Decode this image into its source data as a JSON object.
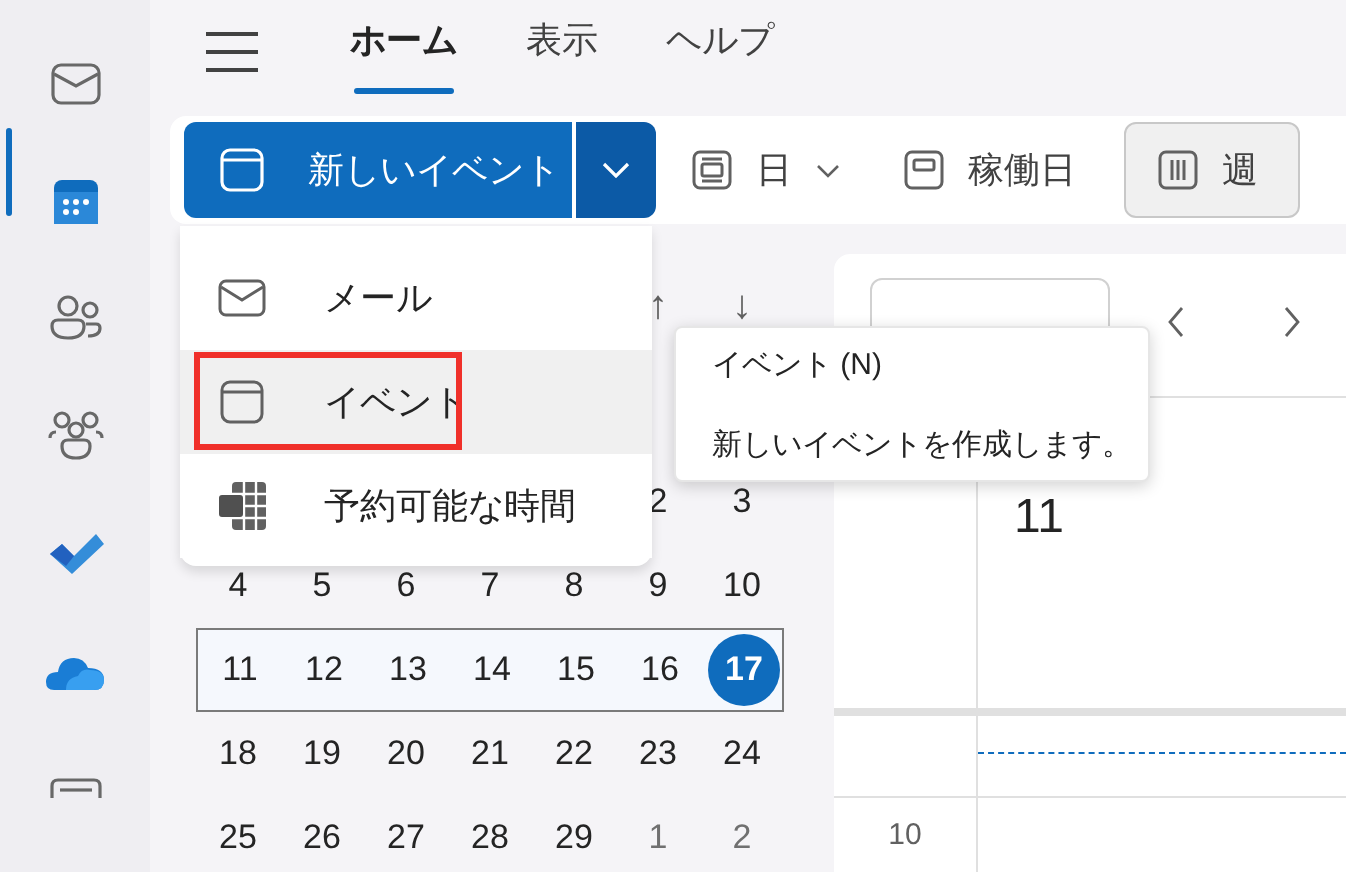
{
  "rail": {
    "items": [
      {
        "kind": "mail",
        "selected": false
      },
      {
        "kind": "calendar",
        "selected": true
      },
      {
        "kind": "people",
        "selected": false
      },
      {
        "kind": "groups",
        "selected": false
      },
      {
        "kind": "todo",
        "selected": false
      },
      {
        "kind": "cloud",
        "selected": false
      },
      {
        "kind": "apps",
        "selected": false
      }
    ]
  },
  "tabs": [
    {
      "label": "ホーム",
      "selected": true
    },
    {
      "label": "表示",
      "selected": false
    },
    {
      "label": "ヘルプ",
      "selected": false
    }
  ],
  "toolbar": {
    "new_event": {
      "label": "新しいイベント"
    },
    "view_buttons": [
      {
        "label": "日",
        "kind": "dropdown",
        "selected": false
      },
      {
        "label": "稼働日",
        "kind": "plain",
        "selected": false
      },
      {
        "label": "週",
        "kind": "plain",
        "selected": true
      }
    ]
  },
  "new_menu": {
    "items": [
      {
        "label": "メール",
        "kind": "mail",
        "hovered": false,
        "highlighted": false
      },
      {
        "label": "イベント",
        "kind": "event",
        "hovered": true,
        "highlighted": true
      },
      {
        "label": "予約可能な時間",
        "kind": "bookings",
        "hovered": false,
        "highlighted": false
      }
    ]
  },
  "tooltip": {
    "title": "イベント (N)",
    "description": "新しいイベントを作成します。"
  },
  "mini_calendar": {
    "nav": [
      "↑",
      "↓"
    ],
    "weeks": [
      {
        "selected": false,
        "days": [
          {
            "label": "2",
            "today": false,
            "muted": false
          },
          {
            "label": "3",
            "today": false,
            "muted": false
          }
        ]
      },
      {
        "selected": false,
        "days": [
          {
            "label": "4",
            "today": false,
            "muted": false
          },
          {
            "label": "5",
            "today": false,
            "muted": false
          },
          {
            "label": "6",
            "today": false,
            "muted": false
          },
          {
            "label": "7",
            "today": false,
            "muted": false
          },
          {
            "label": "8",
            "today": false,
            "muted": false
          },
          {
            "label": "9",
            "today": false,
            "muted": false
          },
          {
            "label": "10",
            "today": false,
            "muted": false
          }
        ]
      },
      {
        "selected": true,
        "days": [
          {
            "label": "11",
            "today": false,
            "muted": false
          },
          {
            "label": "12",
            "today": false,
            "muted": false
          },
          {
            "label": "13",
            "today": false,
            "muted": false
          },
          {
            "label": "14",
            "today": false,
            "muted": false
          },
          {
            "label": "15",
            "today": false,
            "muted": false
          },
          {
            "label": "16",
            "today": false,
            "muted": false
          },
          {
            "label": "17",
            "today": true,
            "muted": false
          }
        ]
      },
      {
        "selected": false,
        "days": [
          {
            "label": "18",
            "today": false,
            "muted": false
          },
          {
            "label": "19",
            "today": false,
            "muted": false
          },
          {
            "label": "20",
            "today": false,
            "muted": false
          },
          {
            "label": "21",
            "today": false,
            "muted": false
          },
          {
            "label": "22",
            "today": false,
            "muted": false
          },
          {
            "label": "23",
            "today": false,
            "muted": false
          },
          {
            "label": "24",
            "today": false,
            "muted": false
          }
        ]
      },
      {
        "selected": false,
        "days": [
          {
            "label": "25",
            "today": false,
            "muted": false
          },
          {
            "label": "26",
            "today": false,
            "muted": false
          },
          {
            "label": "27",
            "today": false,
            "muted": false
          },
          {
            "label": "28",
            "today": false,
            "muted": false
          },
          {
            "label": "29",
            "today": false,
            "muted": false
          },
          {
            "label": "1",
            "today": false,
            "muted": true
          },
          {
            "label": "2",
            "today": false,
            "muted": true
          }
        ]
      }
    ]
  },
  "calendar": {
    "day_number": "11",
    "hours": [
      "10"
    ]
  }
}
